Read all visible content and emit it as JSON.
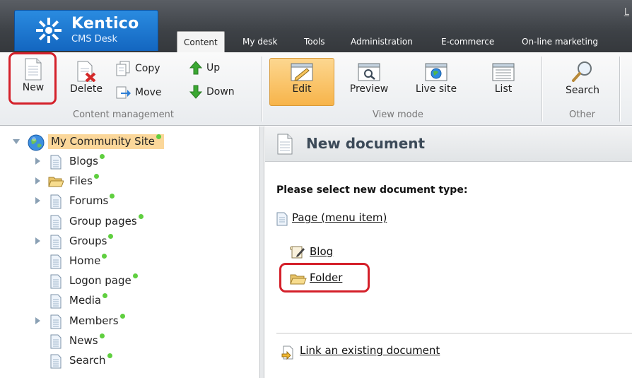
{
  "app": {
    "brand": "Kentico",
    "product": "CMS Desk",
    "corner_text": "L"
  },
  "tabs": [
    {
      "label": "Content",
      "active": true
    },
    {
      "label": "My desk",
      "active": false
    },
    {
      "label": "Tools",
      "active": false
    },
    {
      "label": "Administration",
      "active": false
    },
    {
      "label": "E-commerce",
      "active": false
    },
    {
      "label": "On-line marketing",
      "active": false
    }
  ],
  "toolbar": {
    "content_management": {
      "label": "Content management",
      "new": "New",
      "delete": "Delete",
      "copy": "Copy",
      "move": "Move",
      "up": "Up",
      "down": "Down"
    },
    "view_mode": {
      "label": "View mode",
      "edit": "Edit",
      "preview": "Preview",
      "live_site": "Live site",
      "list": "List"
    },
    "other": {
      "label": "Other",
      "search": "Search"
    }
  },
  "tree": {
    "root": "My Community Site",
    "items": [
      {
        "label": "Blogs",
        "expandable": true,
        "icon": "page-icon"
      },
      {
        "label": "Files",
        "expandable": true,
        "icon": "folder-icon"
      },
      {
        "label": "Forums",
        "expandable": true,
        "icon": "page-icon"
      },
      {
        "label": "Group pages",
        "expandable": false,
        "icon": "page-icon"
      },
      {
        "label": "Groups",
        "expandable": true,
        "icon": "page-icon"
      },
      {
        "label": "Home",
        "expandable": false,
        "icon": "page-icon"
      },
      {
        "label": "Logon page",
        "expandable": false,
        "icon": "page-icon"
      },
      {
        "label": "Media",
        "expandable": false,
        "icon": "page-icon"
      },
      {
        "label": "Members",
        "expandable": true,
        "icon": "page-icon"
      },
      {
        "label": "News",
        "expandable": false,
        "icon": "page-icon"
      },
      {
        "label": "Search",
        "expandable": false,
        "icon": "page-icon"
      }
    ]
  },
  "main": {
    "title": "New document",
    "prompt": "Please select new document type:",
    "types": [
      {
        "label": "Page (menu item)",
        "icon": "page-icon"
      },
      {
        "label": "Blog",
        "icon": "blog-icon"
      },
      {
        "label": "Folder",
        "icon": "folder-icon"
      }
    ],
    "link_existing": "Link an existing document"
  },
  "colors": {
    "highlight": "#d4202a",
    "brand_blue": "#1a73cf",
    "selected_node": "#fbd79a",
    "published_dot": "#5fcf3f"
  }
}
